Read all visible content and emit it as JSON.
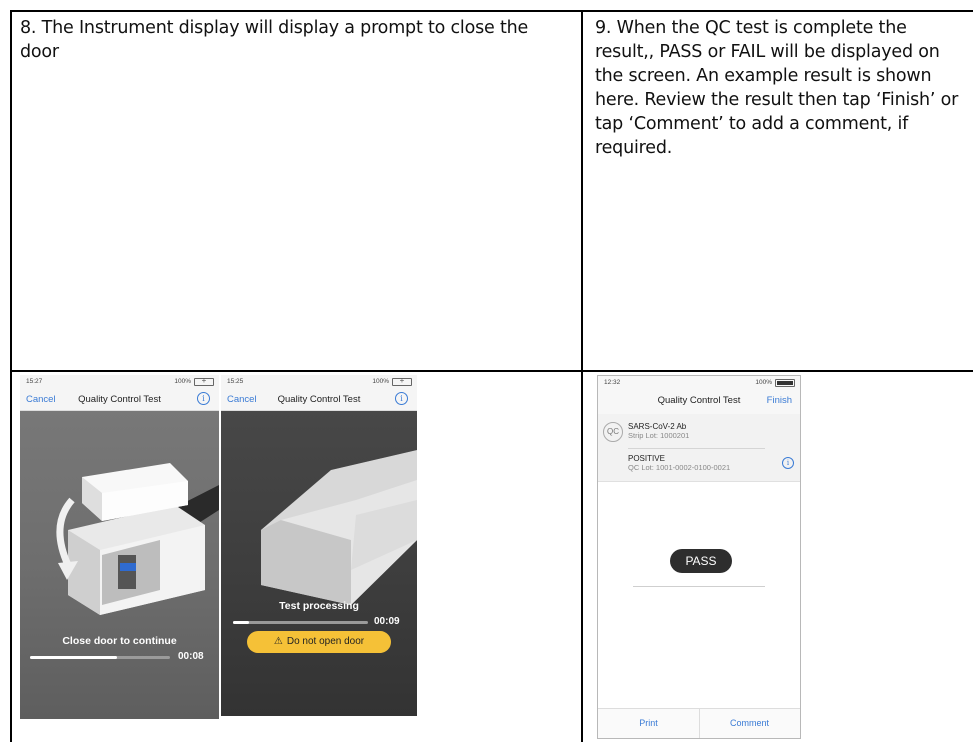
{
  "cells": {
    "step8_text": "8. The Instrument display will display a prompt to close the door",
    "step9_text": "9. When the QC test is complete the result,, PASS or FAIL will be displayed on the screen. An example result is shown here. Review the result then tap ‘Finish’ or tap ‘Comment’ to add a comment, if required."
  },
  "screen1": {
    "time": "15:27",
    "battery_pct": "100%",
    "cancel": "Cancel",
    "title": "Quality Control Test",
    "info": "i",
    "message": "Close door to continue",
    "timer": "00:08",
    "progress": 0.62
  },
  "screen2": {
    "time": "15:25",
    "battery_pct": "100%",
    "cancel": "Cancel",
    "title": "Quality Control Test",
    "info": "i",
    "message": "Test processing",
    "timer": "00:09",
    "progress": 0.12,
    "warning": "Do not open door",
    "warning_icon": "⚠"
  },
  "screen3": {
    "time": "12:32",
    "battery_pct": "100%",
    "title": "Quality Control Test",
    "finish": "Finish",
    "qc_badge": "QC",
    "analyte": "SARS-CoV-2 Ab",
    "strip_lot": "Strip Lot: 1000201",
    "result_word": "POSITIVE",
    "qc_lot": "QC Lot: 1001-0002-0100-0021",
    "info": "i",
    "result": "PASS",
    "print": "Print",
    "comment": "Comment"
  },
  "colors": {
    "accent": "#3a7bd5",
    "warning": "#f5c137",
    "pass_pill": "#2e2e2e"
  }
}
